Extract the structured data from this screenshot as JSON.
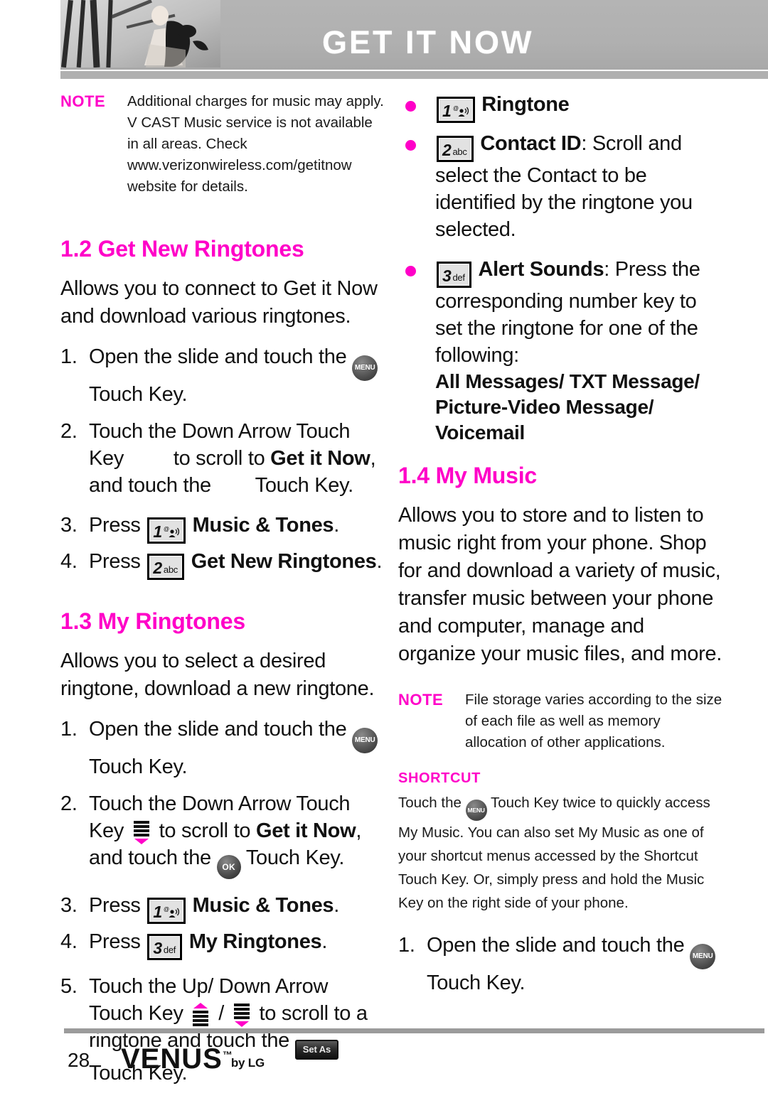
{
  "header": {
    "title": "GET IT NOW"
  },
  "left": {
    "note": {
      "label": "NOTE",
      "body": "Additional charges for music may apply. V CAST Music service is not available in all areas. Check www.verizonwireless.com/getitnow website for details."
    },
    "section_12": {
      "heading": "1.2 Get New Ringtones",
      "intro": "Allows you to connect to Get it Now and download various ringtones.",
      "steps": [
        {
          "num": "1.",
          "pre": "Open the slide and touch the",
          "icon": "menu-touch-key",
          "post": "Touch Key."
        },
        {
          "num": "2.",
          "line1": "Touch the Down Arrow Touch",
          "line2_a": "Key",
          "line2_b": "to scroll to",
          "line2_bold": "Get it Now",
          "line2_c": ",",
          "line3_a": "and touch the",
          "line3_b": "Touch Key."
        },
        {
          "num": "3.",
          "pre": "Press",
          "key_digit": "1",
          "key_sub": "@",
          "bold": "Music & Tones",
          "post": "."
        },
        {
          "num": "4.",
          "pre": "Press",
          "key_digit": "2",
          "key_sub": "abc",
          "bold": "Get New Ringtones",
          "post": "."
        }
      ]
    },
    "section_13": {
      "heading": "1.3 My Ringtones",
      "intro": "Allows you to select a desired ringtone, download a new ringtone.",
      "steps": [
        {
          "num": "1.",
          "pre": "Open the slide and touch the",
          "post": "Touch Key."
        },
        {
          "num": "2.",
          "line1": "Touch the Down Arrow Touch",
          "line2_a": "Key",
          "line2_b": "to scroll to",
          "line2_bold": "Get it Now",
          "line2_c": ",",
          "line3_a": "and touch the",
          "line3_b": "Touch Key."
        },
        {
          "num": "3.",
          "pre": "Press",
          "key_digit": "1",
          "key_sub": "@",
          "bold": "Music & Tones",
          "post": "."
        },
        {
          "num": "4.",
          "pre": "Press",
          "key_digit": "3",
          "key_sub": "def",
          "bold": "My Ringtones",
          "post": "."
        },
        {
          "num": "5.",
          "line1": "Touch the Up/ Down Arrow",
          "line2_a": "Touch Key",
          "line2_sep": "/",
          "line2_b": "to scroll to a",
          "line3_a": "ringtone and touch the",
          "setas_label": "Set As",
          "line4": "Touch Key."
        }
      ]
    }
  },
  "right": {
    "bullets": [
      {
        "key_digit": "1",
        "key_sub": "@",
        "bold": "Ringtone",
        "rest": ""
      },
      {
        "key_digit": "2",
        "key_sub": "abc",
        "bold": "Contact ID",
        "rest": ": Scroll and",
        "cont": "select the Contact to be identified by the ringtone you selected."
      },
      {
        "key_digit": "3",
        "key_sub": "def",
        "bold": "Alert Sounds",
        "rest": ": Press the",
        "cont": "corresponding number key to set the ringtone for one of the following:",
        "bold_list": "All Messages/ TXT Message/ Picture-Video Message/ Voicemail"
      }
    ],
    "section_14": {
      "heading": "1.4 My Music",
      "intro": "Allows you to store and to listen to music right from your phone. Shop for and download a variety of music, transfer music between your phone and computer, manage and organize your music files, and more."
    },
    "note": {
      "label": "NOTE",
      "body": "File storage varies according to the size of each file as well as memory allocation of other applications."
    },
    "shortcut": {
      "label": "SHORTCUT",
      "pre": "Touch the",
      "post": "Touch Key twice to quickly access My Music. You can also set My Music as one of your shortcut menus accessed by the Shortcut Touch Key. Or, simply press and hold the Music Key on the right side of your phone."
    },
    "final_step": {
      "num": "1.",
      "pre": "Open the slide and touch the",
      "post": "Touch Key."
    }
  },
  "footer": {
    "page_number": "28",
    "brand": "VENUS",
    "trademark": "™",
    "by_lg": "by LG"
  },
  "icons": {
    "menu_label": "MENU",
    "ok_label": "OK"
  },
  "colors": {
    "accent": "#ff00c8",
    "header_bar": "#b0b0b0",
    "footer_rule": "#9b9b9b"
  }
}
